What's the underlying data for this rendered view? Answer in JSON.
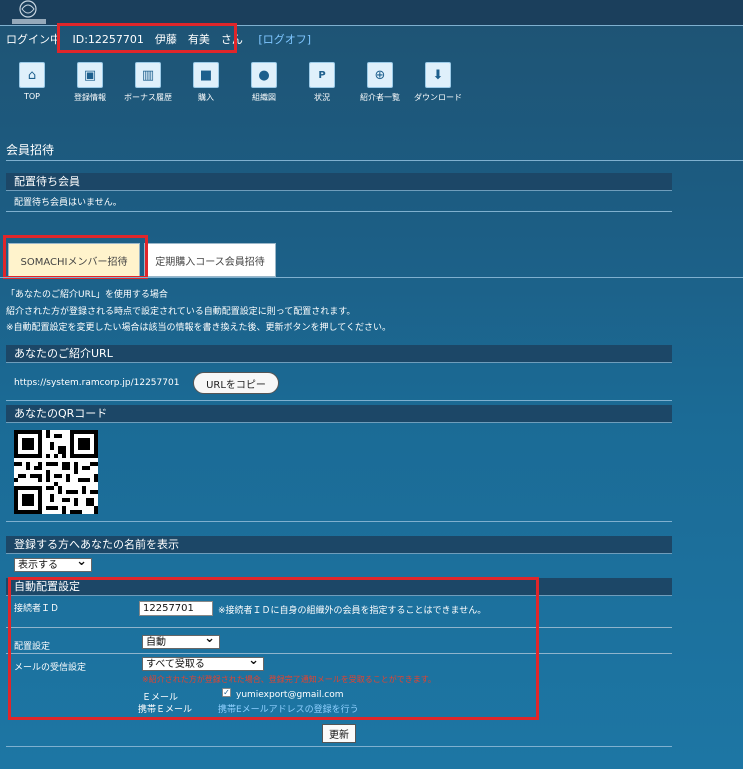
{
  "header": {
    "login_label": "ログイン中",
    "user_id": "ID:12257701　伊藤　有美　さん",
    "logoff": "[ログオフ]"
  },
  "nav": [
    {
      "label": "TOP",
      "icon": "home-icon"
    },
    {
      "label": "登録情報",
      "icon": "id-card-icon"
    },
    {
      "label": "ボーナス履歴",
      "icon": "ledger-icon"
    },
    {
      "label": "購入",
      "icon": "briefcase-icon"
    },
    {
      "label": "組織図",
      "icon": "person-icon"
    },
    {
      "label": "状況",
      "icon": "parking-icon"
    },
    {
      "label": "紹介者一覧",
      "icon": "globe-icon"
    },
    {
      "label": "ダウンロード",
      "icon": "download-icon"
    }
  ],
  "page_title": "会員招待",
  "pending": {
    "title": "配置待ち会員",
    "message": "配置待ち会員はいません。"
  },
  "tabs": [
    {
      "label": "SOMACHIメンバー招待",
      "active": true
    },
    {
      "label": "定期購入コース会員招待",
      "active": false
    }
  ],
  "intro": {
    "line1": "「あなたのご紹介URL」を使用する場合",
    "line2": "紹介された方が登録される時点で設定されている自動配置設定に則って配置されます。",
    "line3": "※自動配置設定を変更したい場合は該当の情報を書き換えた後、更新ボタンを押してください。"
  },
  "url_section": {
    "title": "あなたのご紹介URL",
    "url": "https://system.ramcorp.jp/12257701",
    "copy_button": "URLをコピー"
  },
  "qr_section": {
    "title": "あなたのQRコード"
  },
  "name_display": {
    "title": "登録する方へあなたの名前を表示",
    "selected": "表示する"
  },
  "auto": {
    "title": "自動配置設定",
    "connector_label": "接続者ＩＤ",
    "connector_value": "12257701",
    "connector_note": "※接続者ＩＤに自身の組織外の会員を指定することはできません。",
    "placement_label": "配置設定",
    "placement_value": "自動",
    "mail_label": "メールの受信設定",
    "mail_value": "すべて受取る",
    "mail_warning": "※紹介された方が登録された場合、登録完了通知メールを受取ることができます。",
    "email_label": "Ｅメール",
    "email_value": "yumiexport@gmail.com",
    "mobile_label": "携帯Ｅメール",
    "mobile_link": "携帯Eメールアドレスの登録を行う"
  },
  "update_button": "更新",
  "colors": {
    "highlight_red": "#e0262a",
    "active_tab": "#fff3cc",
    "link": "#8fd0ff",
    "warning": "#e8412c"
  }
}
